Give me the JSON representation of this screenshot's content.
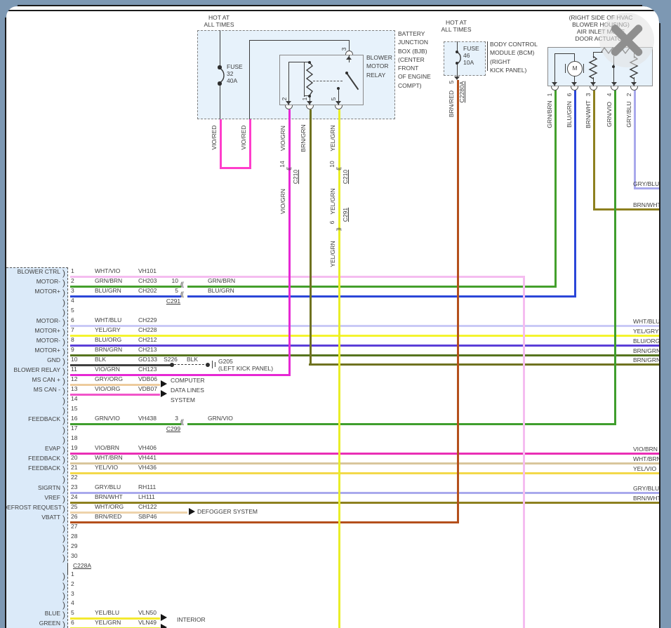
{
  "frame": {
    "background": "#7d98b3"
  },
  "bjb": {
    "hot": [
      "HOT AT",
      "ALL TIMES"
    ],
    "fuse": [
      "FUSE",
      "32",
      "40A"
    ],
    "name": [
      "BATTERY",
      "JUNCTION",
      "BOX (BJB)",
      "(CENTER",
      "FRONT",
      "OF ENGINE",
      "COMPT)"
    ],
    "relay": [
      "BLOWER",
      "MOTOR",
      "RELAY"
    ],
    "relay_pins": [
      "3",
      "2",
      "1",
      "5"
    ]
  },
  "bcm": {
    "hot": [
      "HOT AT",
      "ALL TIMES"
    ],
    "fuse": [
      "FUSE",
      "46",
      "10A"
    ],
    "name": [
      "BODY CONTROL",
      "MODULE (BCM)",
      "(RIGHT",
      "KICK PANEL)"
    ],
    "pin": "5",
    "conn": "C2280A",
    "wire": "BRN/RED"
  },
  "act": {
    "name": [
      "(RIGHT SIDE OF HVAC",
      "BLOWER HOUSING)",
      "AIR INLET MODE",
      "DOOR ACTUATOR"
    ],
    "motor": "M",
    "pins": [
      [
        "1",
        "GRN/BRN"
      ],
      [
        "6",
        "BLU/GRN"
      ],
      [
        "3",
        "BRN/WHT"
      ],
      [
        "4",
        "GRN/VIO"
      ],
      [
        "2",
        "GRY/BLU"
      ]
    ]
  },
  "trunks": {
    "viored": "VIO/RED",
    "viogrn": "VIO/GRN",
    "brngrn": "BRN/GRN",
    "yelgrn": "YEL/GRN",
    "c210": "C210",
    "c291": "C291",
    "p14": "14",
    "p10": "10",
    "p6": "6"
  },
  "mod": {
    "c1name": "C228A",
    "rows1": [
      {
        "n": "1",
        "lbl": "BLOWER CTRL",
        "c": "WHT/VIO",
        "cc": "VH101"
      },
      {
        "n": "2",
        "lbl": "MOTOR-",
        "c": "GRN/BRN",
        "cc": "CH203"
      },
      {
        "n": "3",
        "lbl": "MOTOR+",
        "c": "BLU/GRN",
        "cc": "CH202"
      },
      {
        "n": "4"
      },
      {
        "n": "5"
      },
      {
        "n": "6",
        "lbl": "MOTOR-",
        "c": "WHT/BLU",
        "cc": "CH229"
      },
      {
        "n": "7",
        "lbl": "MOTOR+",
        "c": "YEL/GRY",
        "cc": "CH228"
      },
      {
        "n": "8",
        "lbl": "MOTOR-",
        "c": "BLU/ORG",
        "cc": "CH212"
      },
      {
        "n": "9",
        "lbl": "MOTOR+",
        "c": "BRN/GRN",
        "cc": "CH213"
      },
      {
        "n": "10",
        "lbl": "GND",
        "c": "BLK",
        "cc": "GD133"
      },
      {
        "n": "11",
        "lbl": "BLOWER RELAY",
        "c": "VIO/GRN",
        "cc": "CH123"
      },
      {
        "n": "12",
        "lbl": "MS CAN +",
        "c": "GRY/ORG",
        "cc": "VDB06"
      },
      {
        "n": "13",
        "lbl": "MS CAN -",
        "c": "VIO/ORG",
        "cc": "VDB07"
      },
      {
        "n": "14"
      },
      {
        "n": "15"
      },
      {
        "n": "16",
        "lbl": "FEEDBACK",
        "c": "GRN/VIO",
        "cc": "VH438"
      },
      {
        "n": "17"
      },
      {
        "n": "18"
      },
      {
        "n": "19",
        "lbl": "EVAP",
        "c": "VIO/BRN",
        "cc": "VH406"
      },
      {
        "n": "20",
        "lbl": "FEEDBACK",
        "c": "WHT/BRN",
        "cc": "VH441"
      },
      {
        "n": "21",
        "lbl": "FEEDBACK",
        "c": "YEL/VIO",
        "cc": "VH436"
      },
      {
        "n": "22"
      },
      {
        "n": "23",
        "lbl": "SIGRTN",
        "c": "GRY/BLU",
        "cc": "RH111"
      },
      {
        "n": "24",
        "lbl": "VREF",
        "c": "BRN/WHT",
        "cc": "LH111"
      },
      {
        "n": "25",
        "lbl": "DEFROST REQUEST",
        "c": "WHT/ORG",
        "cc": "CH122"
      },
      {
        "n": "26",
        "lbl": "VBATT",
        "c": "BRN/RED",
        "cc": "SBP46"
      },
      {
        "n": "27"
      },
      {
        "n": "28"
      },
      {
        "n": "29"
      },
      {
        "n": "30"
      }
    ],
    "rows2": [
      {
        "n": "1"
      },
      {
        "n": "2"
      },
      {
        "n": "3"
      },
      {
        "n": "4"
      },
      {
        "n": "5",
        "lbl": "BLUE",
        "c": "YEL/BLU",
        "cc": "VLN50"
      },
      {
        "n": "6",
        "lbl": "GREEN",
        "c": "YEL/GRN",
        "cc": "VLN49"
      }
    ],
    "gnd": {
      "splice": "S226",
      "c2": "BLK",
      "g": "G205",
      "loc": "(LEFT KICK PANEL)"
    },
    "canbus": [
      "COMPUTER",
      "DATA LINES",
      "SYSTEM"
    ],
    "defog": "DEFOGGER SYSTEM",
    "interior": "INTERIOR",
    "inline": {
      "r2pin": "10",
      "r3pin": "5",
      "c291": "C291",
      "r16pin": "3",
      "c299": "C299",
      "cont2": "GRN/BRN",
      "cont3": "BLU/GRN",
      "cont16": "GRN/VIO"
    }
  },
  "exit_labels": [
    "GRY/BLU",
    "BRN/WHT",
    "WHT/BLU",
    "YEL/GRY",
    "BLU/ORG",
    "BRN/GRN",
    "BRN/GRN",
    "VIO/BRN",
    "WHT/BRN",
    "YEL/VIO",
    "GRY/BLU",
    "BRN/WHT"
  ],
  "colors": {
    "WHT/VIO": "#f5bdf0",
    "GRN/BRN": "#44a02c",
    "BLU/GRN": "#2b46d8",
    "WHT/BLU": "#c9c9f6",
    "YEL/GRY": "#f4f42e",
    "BLU/ORG": "#5b3fd8",
    "BRN/GRN": "#56741e",
    "BLK": "#404040",
    "VIO/GRN": "#e628d4",
    "GRY/ORG": "#edcb9d",
    "VIO/ORG": "#f155c9",
    "GRN/VIO": "#3f9e2d",
    "VIO/BRN": "#ea2fb5",
    "WHT/BRN": "#d9c69c",
    "YEL/VIO": "#f3d94a",
    "GRY/BLU": "#a9a9ec",
    "BRN/WHT": "#8d801f",
    "WHT/ORG": "#eed3ab",
    "BRN/RED": "#b4501c",
    "YEL/BLU": "#f3e930",
    "YEL/GRN": "#e9ee28",
    "VIO/RED": "#ff3dcb",
    "BRN/GRN-RELAY": "#6f7220"
  }
}
